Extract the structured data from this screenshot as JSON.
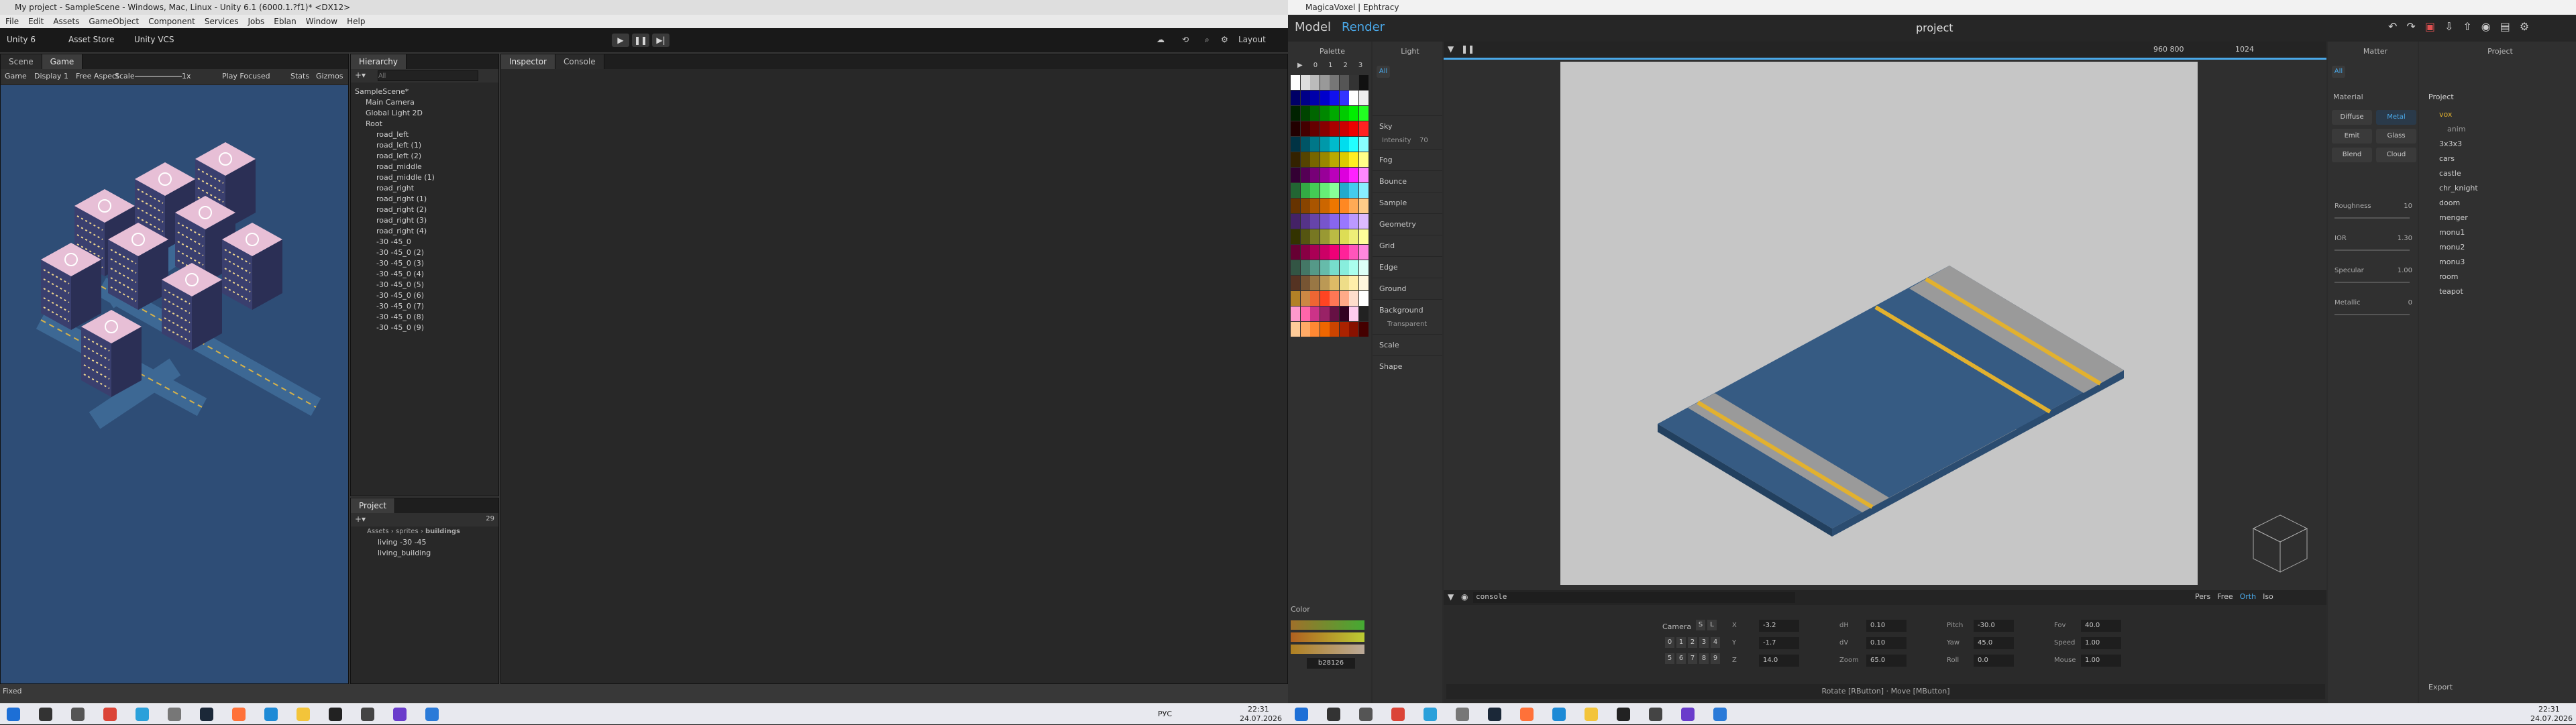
{
  "unity": {
    "window_title": "My project - SampleScene - Windows, Mac, Linux - Unity 6.1 (6000.1.?f1)* <DX12>",
    "menu": [
      "File",
      "Edit",
      "Assets",
      "GameObject",
      "Component",
      "Services",
      "Jobs",
      "Eblan",
      "Window",
      "Help"
    ],
    "toolbar": {
      "account": "Unity 6",
      "cloud": "Asset Store",
      "vcs": "Unity VCS",
      "layout": "Layout"
    },
    "game_tabs": [
      "Scene",
      "Game"
    ],
    "game_bar": {
      "mode": "Game",
      "display": "Display 1",
      "aspect": "Free Aspect",
      "scale_label": "Scale",
      "scale_value": "1x",
      "play_focused": "Play Focused",
      "stats": "Stats",
      "gizmos": "Gizmos"
    },
    "hierarchy_tab": "Hierarchy",
    "hierarchy_search_placeholder": "All",
    "hierarchy": [
      "SampleScene*",
      "Main Camera",
      "Global Light 2D",
      "Root",
      "road_left",
      "road_left (1)",
      "road_left (2)",
      "road_middle",
      "road_middle (1)",
      "road_right",
      "road_right (1)",
      "road_right (2)",
      "road_right (3)",
      "road_right (4)",
      "-30 -45_0",
      "-30 -45_0 (2)",
      "-30 -45_0 (3)",
      "-30 -45_0 (4)",
      "-30 -45_0 (5)",
      "-30 -45_0 (6)",
      "-30 -45_0 (7)",
      "-30 -45_0 (8)",
      "-30 -45_0 (9)"
    ],
    "inspector_tabs": [
      "Inspector",
      "Console"
    ],
    "project_tab": "Project",
    "project_breadcrumb": [
      "Assets",
      "sprites",
      "buildings"
    ],
    "project_items": [
      "living -30 -45",
      "living_building"
    ],
    "project_count": "29",
    "status": "Fixed"
  },
  "magica": {
    "window_title": "MagicaVoxel | Ephtracy",
    "tabs": [
      "Model",
      "Render"
    ],
    "project_name": "project",
    "palette_title": "Palette",
    "palette_pages": [
      "0",
      "1",
      "2",
      "3"
    ],
    "light_title": "Light",
    "light_modes": [
      "All"
    ],
    "light_sections": [
      "Sky",
      "Fog",
      "Bounce",
      "Sample",
      "Geometry",
      "Grid",
      "Edge",
      "Ground",
      "Background",
      "Scale",
      "Shape"
    ],
    "sky_intensity_label": "Intensity",
    "sky_intensity_value": "70",
    "background_transparent": "Transparent",
    "render_size": "960   800",
    "render_samples": "1024",
    "matter_title": "Matter",
    "matter_filter": "All",
    "material_label": "Material",
    "material_types": [
      "Diffuse",
      "Metal",
      "Emit",
      "Glass",
      "Blend",
      "Cloud"
    ],
    "material_params": [
      {
        "label": "Roughness",
        "value": "10"
      },
      {
        "label": "IOR",
        "value": "1.30"
      },
      {
        "label": "Specular",
        "value": "1.00"
      },
      {
        "label": "Metallic",
        "value": "0"
      }
    ],
    "project_title": "Project",
    "project_root": "Project",
    "project_items": [
      "vox",
      "anim",
      "3x3x3",
      "cars",
      "castle",
      "chr_knight",
      "doom",
      "menger",
      "monu1",
      "monu2",
      "monu3",
      "room",
      "teapot"
    ],
    "project_export": "Export",
    "color_title": "Color",
    "color_hex": "b28126",
    "console_label": "console",
    "camera_modes": [
      "Pers",
      "Free",
      "Orth",
      "Iso"
    ],
    "camera_label": "Camera",
    "camera_slots_a": [
      "S",
      "L"
    ],
    "camera_slots_b": [
      "0",
      "1",
      "2",
      "3",
      "4"
    ],
    "camera_slots_c": [
      "5",
      "6",
      "7",
      "8",
      "9"
    ],
    "camera_values": [
      {
        "label": "X",
        "value": "-3.2"
      },
      {
        "label": "Y",
        "value": "-1.7"
      },
      {
        "label": "Z",
        "value": "14.0"
      },
      {
        "label": "dH",
        "value": "0.10"
      },
      {
        "label": "dV",
        "value": "0.10"
      },
      {
        "label": "Zoom",
        "value": "65.0"
      },
      {
        "label": "Pitch",
        "value": "-30.0"
      },
      {
        "label": "Yaw",
        "value": "45.0"
      },
      {
        "label": "Roll",
        "value": "0.0"
      },
      {
        "label": "Fov",
        "value": "40.0"
      },
      {
        "label": "Speed",
        "value": "1.00"
      },
      {
        "label": "Mouse",
        "value": "1.00"
      }
    ],
    "hint": "Rotate [RButton] · Move [MButton]",
    "colors": {
      "accent": "#4aa8e8",
      "viewport_bg": "#c6c6c6",
      "road": "#365b83",
      "lane": "#e2b12f"
    }
  },
  "taskbar": {
    "lang": "РУС",
    "left_time": "22:31",
    "left_date": "24.07.2026",
    "right_time": "22:31",
    "right_date": "24.07.2026"
  }
}
